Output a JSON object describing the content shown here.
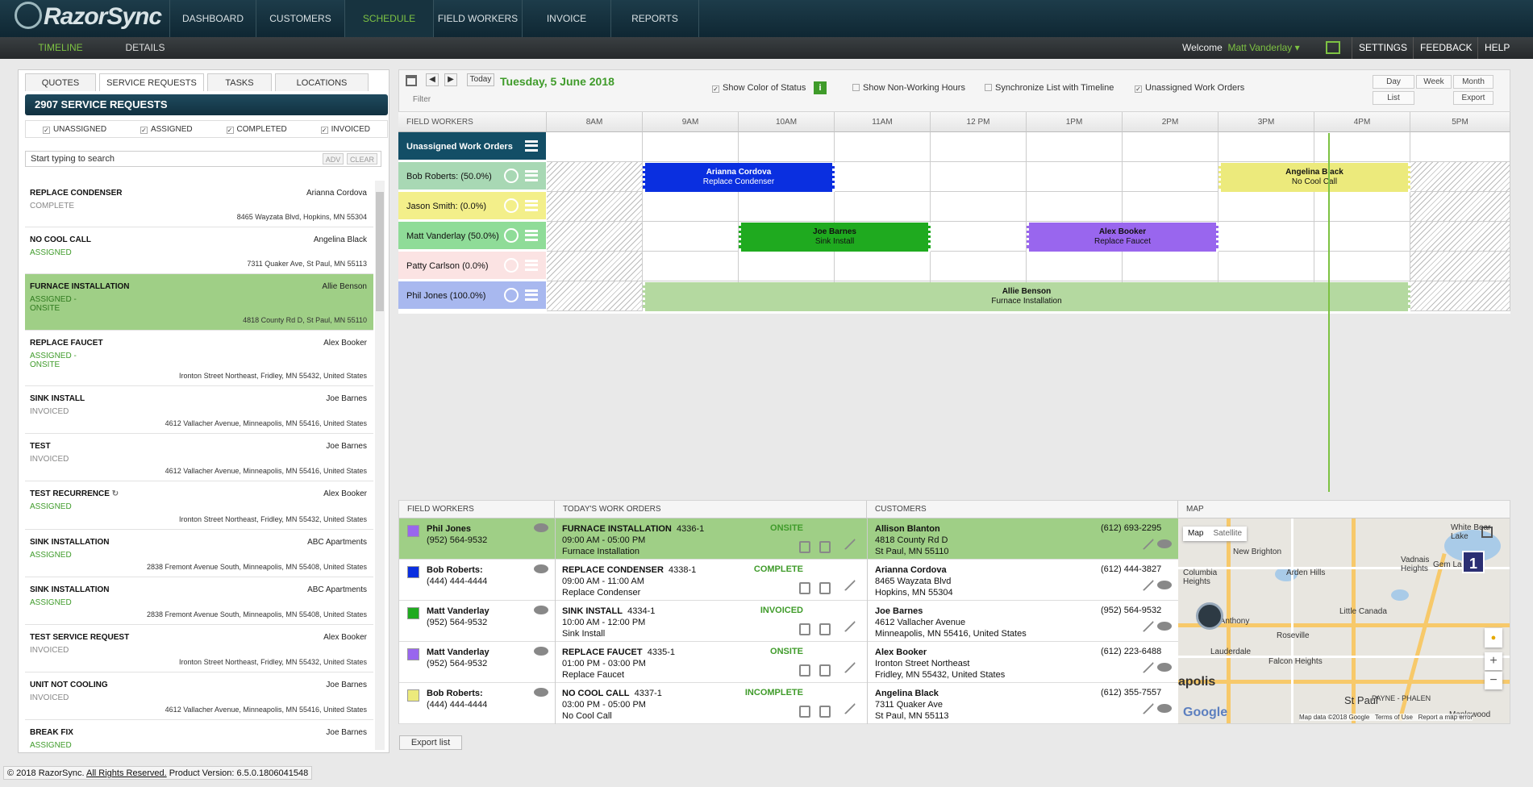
{
  "nav": {
    "items": [
      "DASHBOARD",
      "CUSTOMERS",
      "SCHEDULE",
      "FIELD WORKERS",
      "INVOICE",
      "REPORTS"
    ]
  },
  "subnav": {
    "timeline": "TIMELINE",
    "details": "DETAILS",
    "welcome": "Welcome",
    "user": "Matt Vanderlay",
    "settings": "SETTINGS",
    "feedback": "FEEDBACK",
    "help": "HELP"
  },
  "left": {
    "tabs": [
      "QUOTES",
      "SERVICE REQUESTS",
      "TASKS",
      "LOCATIONS"
    ],
    "header": "2907 SERVICE REQUESTS",
    "filters": [
      "UNASSIGNED",
      "ASSIGNED",
      "COMPLETED",
      "INVOICED"
    ],
    "search_placeholder": "Start typing to search",
    "adv": "ADV",
    "clear": "CLEAR",
    "items": [
      {
        "title": "REPLACE CONDENSER",
        "customer": "Arianna Cordova",
        "status": "COMPLETE",
        "address": "8465 Wayzata Blvd, Hopkins, MN 55304"
      },
      {
        "title": "NO COOL CALL",
        "customer": "Angelina Black",
        "status": "ASSIGNED",
        "address": "7311 Quaker Ave, St Paul, MN 55113"
      },
      {
        "title": "FURNACE INSTALLATION",
        "customer": "Allie Benson",
        "status": "ASSIGNED - ONSITE",
        "address": "4818 County Rd D, St Paul, MN 55110"
      },
      {
        "title": "REPLACE FAUCET",
        "customer": "Alex Booker",
        "status": "ASSIGNED - ONSITE",
        "address": "Ironton Street Northeast, Fridley, MN 55432, United States"
      },
      {
        "title": "SINK INSTALL",
        "customer": "Joe Barnes",
        "status": "INVOICED",
        "address": "4612 Vallacher Avenue, Minneapolis, MN 55416, United States"
      },
      {
        "title": "TEST",
        "customer": "Joe Barnes",
        "status": "INVOICED",
        "address": "4612 Vallacher Avenue, Minneapolis, MN 55416, United States"
      },
      {
        "title": "TEST RECURRENCE",
        "customer": "Alex Booker",
        "status": "ASSIGNED",
        "address": "Ironton Street Northeast, Fridley, MN 55432, United States"
      },
      {
        "title": "SINK INSTALLATION",
        "customer": "ABC Apartments",
        "status": "ASSIGNED",
        "address": "2838 Fremont Avenue South, Minneapolis, MN 55408, United States"
      },
      {
        "title": "SINK INSTALLATION",
        "customer": "ABC Apartments",
        "status": "ASSIGNED",
        "address": "2838 Fremont Avenue South, Minneapolis, MN 55408, United States"
      },
      {
        "title": "TEST SERVICE REQUEST",
        "customer": "Alex Booker",
        "status": "INVOICED",
        "address": "Ironton Street Northeast, Fridley, MN 55432, United States"
      },
      {
        "title": "UNIT NOT COOLING",
        "customer": "Joe Barnes",
        "status": "INVOICED",
        "address": "4612 Vallacher Avenue, Minneapolis, MN 55416, United States"
      },
      {
        "title": "BREAK FIX",
        "customer": "Joe Barnes",
        "status": "ASSIGNED",
        "address": ""
      }
    ]
  },
  "toolbar": {
    "today": "Today",
    "date": "Tuesday, 5 June 2018",
    "filter": "Filter",
    "show_color": "Show Color of Status",
    "non_working": "Show Non-Working Hours",
    "sync": "Synchronize List with Timeline",
    "unassigned": "Unassigned Work Orders",
    "day": "Day",
    "week": "Week",
    "month": "Month",
    "list": "List",
    "export": "Export"
  },
  "timeline": {
    "header": "FIELD WORKERS",
    "hours": [
      "8AM",
      "9AM",
      "10AM",
      "11AM",
      "12 PM",
      "1PM",
      "2PM",
      "3PM",
      "4PM",
      "5PM"
    ],
    "rows": [
      {
        "name": "Unassigned Work Orders",
        "color": "#134e66"
      },
      {
        "name": "Bob Roberts:  (50.0%)",
        "color": "#a8d8b4"
      },
      {
        "name": "Jason Smith:  (0.0%)",
        "color": "#f3ef8a"
      },
      {
        "name": "Matt Vanderlay  (50.0%)",
        "color": "#8fdc98"
      },
      {
        "name": "Patty Carlson  (0.0%)",
        "color": "#fbe3e3"
      },
      {
        "name": "Phil Jones  (100.0%)",
        "color": "#a8b8ef"
      }
    ],
    "jobs": [
      {
        "name": "Arianna Cordova",
        "task": "Replace Condenser",
        "color": "#0a2fe0"
      },
      {
        "name": "Angelina Black",
        "task": "No Cool Call",
        "color": "#ecea7c"
      },
      {
        "name": "Joe Barnes",
        "task": "Sink Install",
        "color": "#1faa1f"
      },
      {
        "name": "Alex Booker",
        "task": "Replace Faucet",
        "color": "#9966ee"
      },
      {
        "name": "Allie Benson",
        "task": "Furnace Installation",
        "color": "#b4d9a0"
      }
    ]
  },
  "bottom": {
    "headers": [
      "FIELD WORKERS",
      "TODAY'S WORK ORDERS",
      "CUSTOMERS",
      "MAP"
    ],
    "rows": [
      {
        "worker": "Phil Jones",
        "phone": "(952) 564-9532",
        "color": "#9966ee",
        "wo": "FURNACE INSTALLATION",
        "wo_id": "4336-1",
        "time": "09:00 AM - 05:00 PM",
        "desc": "Furnace Installation",
        "status": "ONSITE",
        "cust": "Allison Blanton",
        "addr1": "4818 County Rd D",
        "addr2": "St Paul, MN 55110",
        "cphone": "(612) 693-2295"
      },
      {
        "worker": "Bob Roberts:",
        "phone": "(444) 444-4444",
        "color": "#0a2fe0",
        "wo": "REPLACE CONDENSER",
        "wo_id": "4338-1",
        "time": "09:00 AM - 11:00 AM",
        "desc": "Replace Condenser",
        "status": "COMPLETE",
        "cust": "Arianna Cordova",
        "addr1": "8465 Wayzata Blvd",
        "addr2": "Hopkins, MN 55304",
        "cphone": "(612) 444-3827"
      },
      {
        "worker": "Matt Vanderlay",
        "phone": "(952) 564-9532",
        "color": "#1faa1f",
        "wo": "SINK INSTALL",
        "wo_id": "4334-1",
        "time": "10:00 AM - 12:00 PM",
        "desc": "Sink Install",
        "status": "INVOICED",
        "cust": "Joe Barnes",
        "addr1": "4612 Vallacher Avenue",
        "addr2": "Minneapolis, MN 55416, United States",
        "cphone": "(952) 564-9532"
      },
      {
        "worker": "Matt Vanderlay",
        "phone": "(952) 564-9532",
        "color": "#9966ee",
        "wo": "REPLACE FAUCET",
        "wo_id": "4335-1",
        "time": "01:00 PM - 03:00 PM",
        "desc": "Replace Faucet",
        "status": "ONSITE",
        "cust": "Alex Booker",
        "addr1": "Ironton Street Northeast",
        "addr2": "Fridley, MN 55432, United States",
        "cphone": "(612) 223-6488"
      },
      {
        "worker": "Bob Roberts:",
        "phone": "(444) 444-4444",
        "color": "#ecea7c",
        "wo": "NO COOL CALL",
        "wo_id": "4337-1",
        "time": "03:00 PM - 05:00 PM",
        "desc": "No Cool Call",
        "status": "INCOMPLETE",
        "cust": "Angelina Black",
        "addr1": "7311 Quaker Ave",
        "addr2": "St Paul, MN 55113",
        "cphone": "(612) 355-7557"
      }
    ],
    "map": {
      "map": "Map",
      "satellite": "Satellite",
      "labels": [
        "New Brighton",
        "White Bear Lake",
        "Vadnais Heights",
        "Gem Lake",
        "Columbia Heights",
        "Arden Hills",
        "Little Canada",
        "Roseville",
        "Falcon Heights",
        "Maplewood",
        "St Anthony",
        "Lauderdale",
        "St Paul",
        "apolis",
        "PAYNE - PHALEN"
      ],
      "marker": "1",
      "google": "Google",
      "credits": "Map data ©2018 Google",
      "terms": "Terms of Use",
      "report": "Report a map error"
    },
    "export_list": "Export list"
  },
  "footer": {
    "copy": "© 2018 RazorSync.",
    "rights": "All Rights Reserved.",
    "version": "Product Version: 6.5.0.1806041548"
  }
}
